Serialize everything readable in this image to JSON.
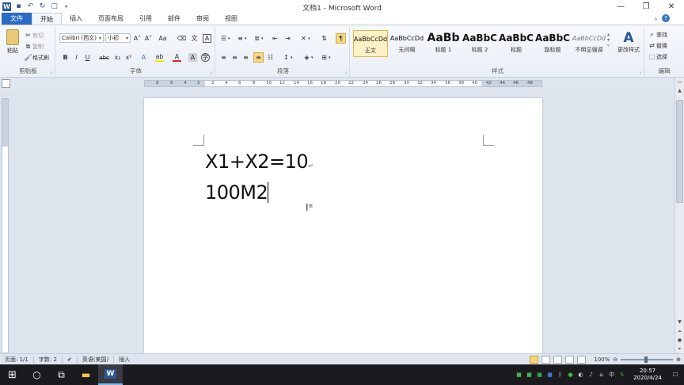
{
  "window": {
    "title": "文档1 - Microsoft Word",
    "minimize_icon": "minimize-icon",
    "restore_icon": "restore-icon",
    "close_icon": "close-icon"
  },
  "tabs": [
    {
      "label": "文件"
    },
    {
      "label": "开始"
    },
    {
      "label": "插入"
    },
    {
      "label": "页面布局"
    },
    {
      "label": "引用"
    },
    {
      "label": "邮件"
    },
    {
      "label": "审阅"
    },
    {
      "label": "视图"
    }
  ],
  "ribbon": {
    "clipboard": {
      "label": "剪贴板",
      "paste": "粘贴",
      "cut": "剪切",
      "copy": "复制",
      "format_painter": "格式刷"
    },
    "font": {
      "label": "字体",
      "font_name": "Calibri (西文)",
      "font_size": "小初"
    },
    "paragraph": {
      "label": "段落"
    },
    "styles": {
      "label": "样式",
      "items": [
        {
          "sample": "AaBbCcDd",
          "name": "正文"
        },
        {
          "sample": "AaBbCcDd",
          "name": "无间隔"
        },
        {
          "sample": "AaBb",
          "name": "标题 1"
        },
        {
          "sample": "AaBbC",
          "name": "标题 2"
        },
        {
          "sample": "AaBbC",
          "name": "标题"
        },
        {
          "sample": "AaBbC",
          "name": "副标题"
        },
        {
          "sample": "AaBbCcDd",
          "name": "不明显强调"
        }
      ],
      "change_styles": "更改样式"
    },
    "editing": {
      "label": "编辑",
      "find": "查找",
      "replace": "替换",
      "select": "选择"
    }
  },
  "ruler": {
    "ticks": [
      "8",
      "6",
      "4",
      "2",
      "2",
      "4",
      "6",
      "8",
      "10",
      "12",
      "14",
      "16",
      "18",
      "20",
      "22",
      "24",
      "26",
      "28",
      "30",
      "32",
      "34",
      "36",
      "38",
      "40",
      "42",
      "44",
      "46",
      "48"
    ]
  },
  "document": {
    "lines": [
      "X1+X2=10",
      "100M2"
    ]
  },
  "status": {
    "page": "页面: 1/1",
    "words": "字数: 2",
    "language": "英语(美国)",
    "insert": "插入",
    "zoom": "100%"
  },
  "taskbar": {
    "time": "20:57",
    "date": "2020/4/24"
  }
}
